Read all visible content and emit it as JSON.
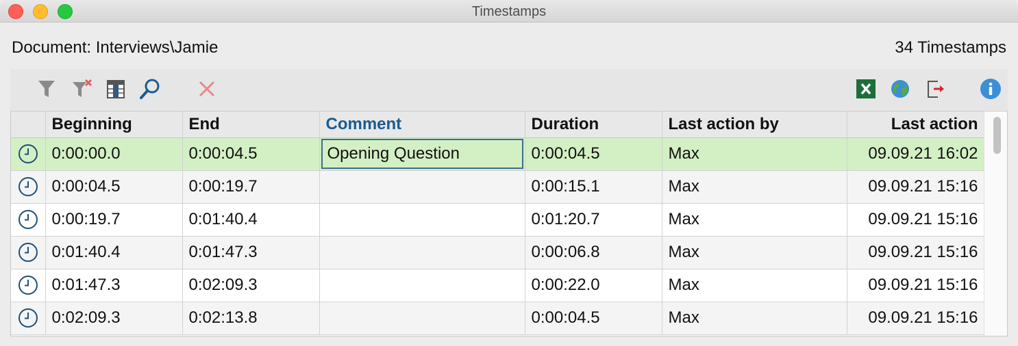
{
  "window": {
    "title": "Timestamps"
  },
  "header": {
    "document_label": "Document: Interviews\\Jamie",
    "count_label": "34 Timestamps"
  },
  "toolbar": {
    "left_icons": [
      "filter-icon",
      "clear-filter-icon",
      "columns-icon",
      "search-icon",
      "delete-icon"
    ],
    "right_icons": [
      "excel-export-icon",
      "web-export-icon",
      "export-icon",
      "info-icon"
    ]
  },
  "table": {
    "columns": [
      "",
      "Beginning",
      "End",
      "Comment",
      "Duration",
      "Last action by",
      "Last action"
    ],
    "sorted_column": "Comment",
    "rows": [
      {
        "beginning": "0:00:00.0",
        "end": "0:00:04.5",
        "comment": "Opening Question",
        "duration": "0:00:04.5",
        "last_action_by": "Max",
        "last_action": "09.09.21 16:02"
      },
      {
        "beginning": "0:00:04.5",
        "end": "0:00:19.7",
        "comment": "",
        "duration": "0:00:15.1",
        "last_action_by": "Max",
        "last_action": "09.09.21 15:16"
      },
      {
        "beginning": "0:00:19.7",
        "end": "0:01:40.4",
        "comment": "",
        "duration": "0:01:20.7",
        "last_action_by": "Max",
        "last_action": "09.09.21 15:16"
      },
      {
        "beginning": "0:01:40.4",
        "end": "0:01:47.3",
        "comment": "",
        "duration": "0:00:06.8",
        "last_action_by": "Max",
        "last_action": "09.09.21 15:16"
      },
      {
        "beginning": "0:01:47.3",
        "end": "0:02:09.3",
        "comment": "",
        "duration": "0:00:22.0",
        "last_action_by": "Max",
        "last_action": "09.09.21 15:16"
      },
      {
        "beginning": "0:02:09.3",
        "end": "0:02:13.8",
        "comment": "",
        "duration": "0:00:04.5",
        "last_action_by": "Max",
        "last_action": "09.09.21 15:16"
      }
    ]
  },
  "colors": {
    "selected_row": "#d3efc4",
    "sorted_header": "#1a5c93",
    "clock_icon": "#1f4f77"
  }
}
